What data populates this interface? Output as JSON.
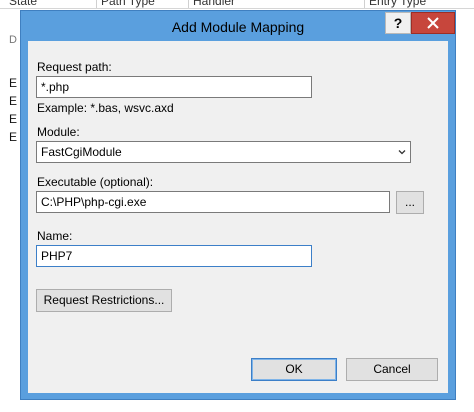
{
  "background": {
    "columns": [
      "State",
      "Path Type",
      "Handler",
      "Entry Type"
    ],
    "small_letter": "D",
    "row_letters": [
      "E",
      "E",
      "E",
      "E"
    ]
  },
  "dialog": {
    "title": "Add Module Mapping",
    "help_label": "?",
    "close_label": "x",
    "request_path": {
      "label": "Request path:",
      "value": "*.php",
      "example": "Example: *.bas, wsvc.axd"
    },
    "module": {
      "label": "Module:",
      "value": "FastCgiModule"
    },
    "executable": {
      "label": "Executable (optional):",
      "value": "C:\\PHP\\php-cgi.exe",
      "browse_label": "..."
    },
    "name": {
      "label": "Name:",
      "value": "PHP7"
    },
    "restrictions_label": "Request Restrictions...",
    "ok_label": "OK",
    "cancel_label": "Cancel"
  },
  "colors": {
    "title_bar": "#5a9fde",
    "close_button": "#c7463c",
    "focus_border": "#3c7fc8"
  }
}
